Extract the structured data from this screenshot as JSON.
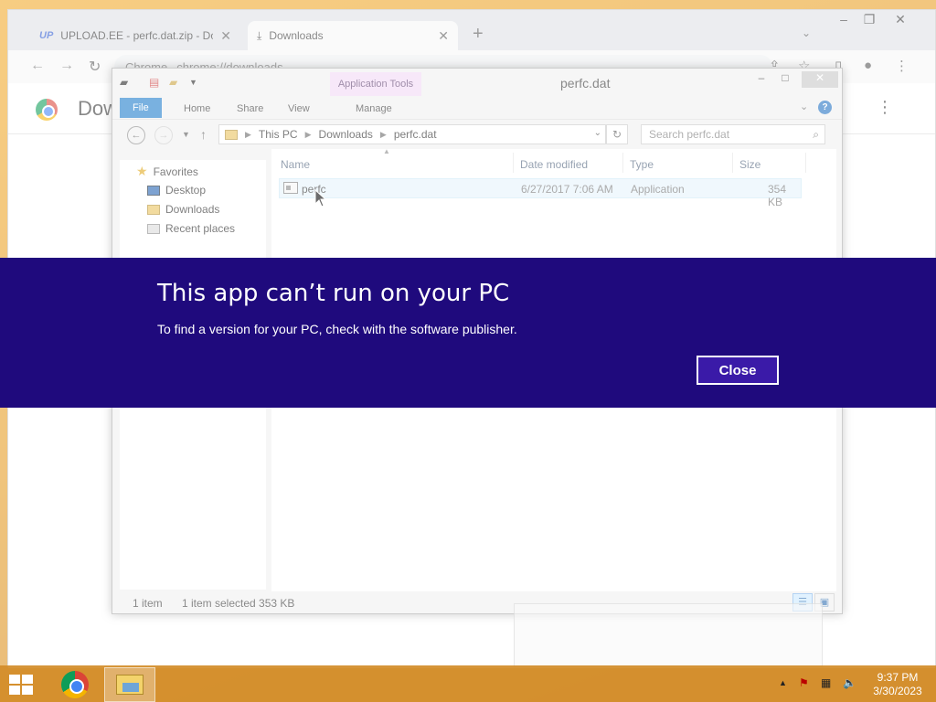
{
  "chrome": {
    "tabs": [
      {
        "favicon": "UP",
        "label": "UPLOAD.EE - perfc.dat.zip - Dow",
        "close": "✕"
      },
      {
        "favicon": "download-icon",
        "label": "Downloads",
        "close": "✕"
      }
    ],
    "new_tab": "+",
    "address": {
      "site_label": "Chrome",
      "url": "chrome://downloads"
    },
    "page_title": "Dow"
  },
  "explorer": {
    "ribbon_context_tab": "Application Tools",
    "window_title": "perfc.dat",
    "ribbon_tabs": [
      "File",
      "Home",
      "Share",
      "View",
      "Manage"
    ],
    "breadcrumb": [
      "This PC",
      "Downloads",
      "perfc.dat"
    ],
    "search_placeholder": "Search perfc.dat",
    "nav": {
      "favorites": "Favorites",
      "items": [
        "Desktop",
        "Downloads",
        "Recent places"
      ]
    },
    "columns": [
      "Name",
      "Date modified",
      "Type",
      "Size"
    ],
    "files": [
      {
        "name": "perfc",
        "date_modified": "6/27/2017 7:06 AM",
        "type": "Application",
        "size": "354 KB",
        "selected": true
      }
    ],
    "status": {
      "count": "1 item",
      "selection": "1 item selected  353 KB"
    }
  },
  "dialog": {
    "title": "This app can’t run on your PC",
    "message": "To find a version for your PC, check with the software publisher.",
    "close_label": "Close",
    "banner_color": "#1f0a7d"
  },
  "taskbar": {
    "apps": [
      "chrome-icon",
      "file-explorer-icon"
    ],
    "clock": {
      "time": "9:37 PM",
      "date": "3/30/2023"
    }
  }
}
